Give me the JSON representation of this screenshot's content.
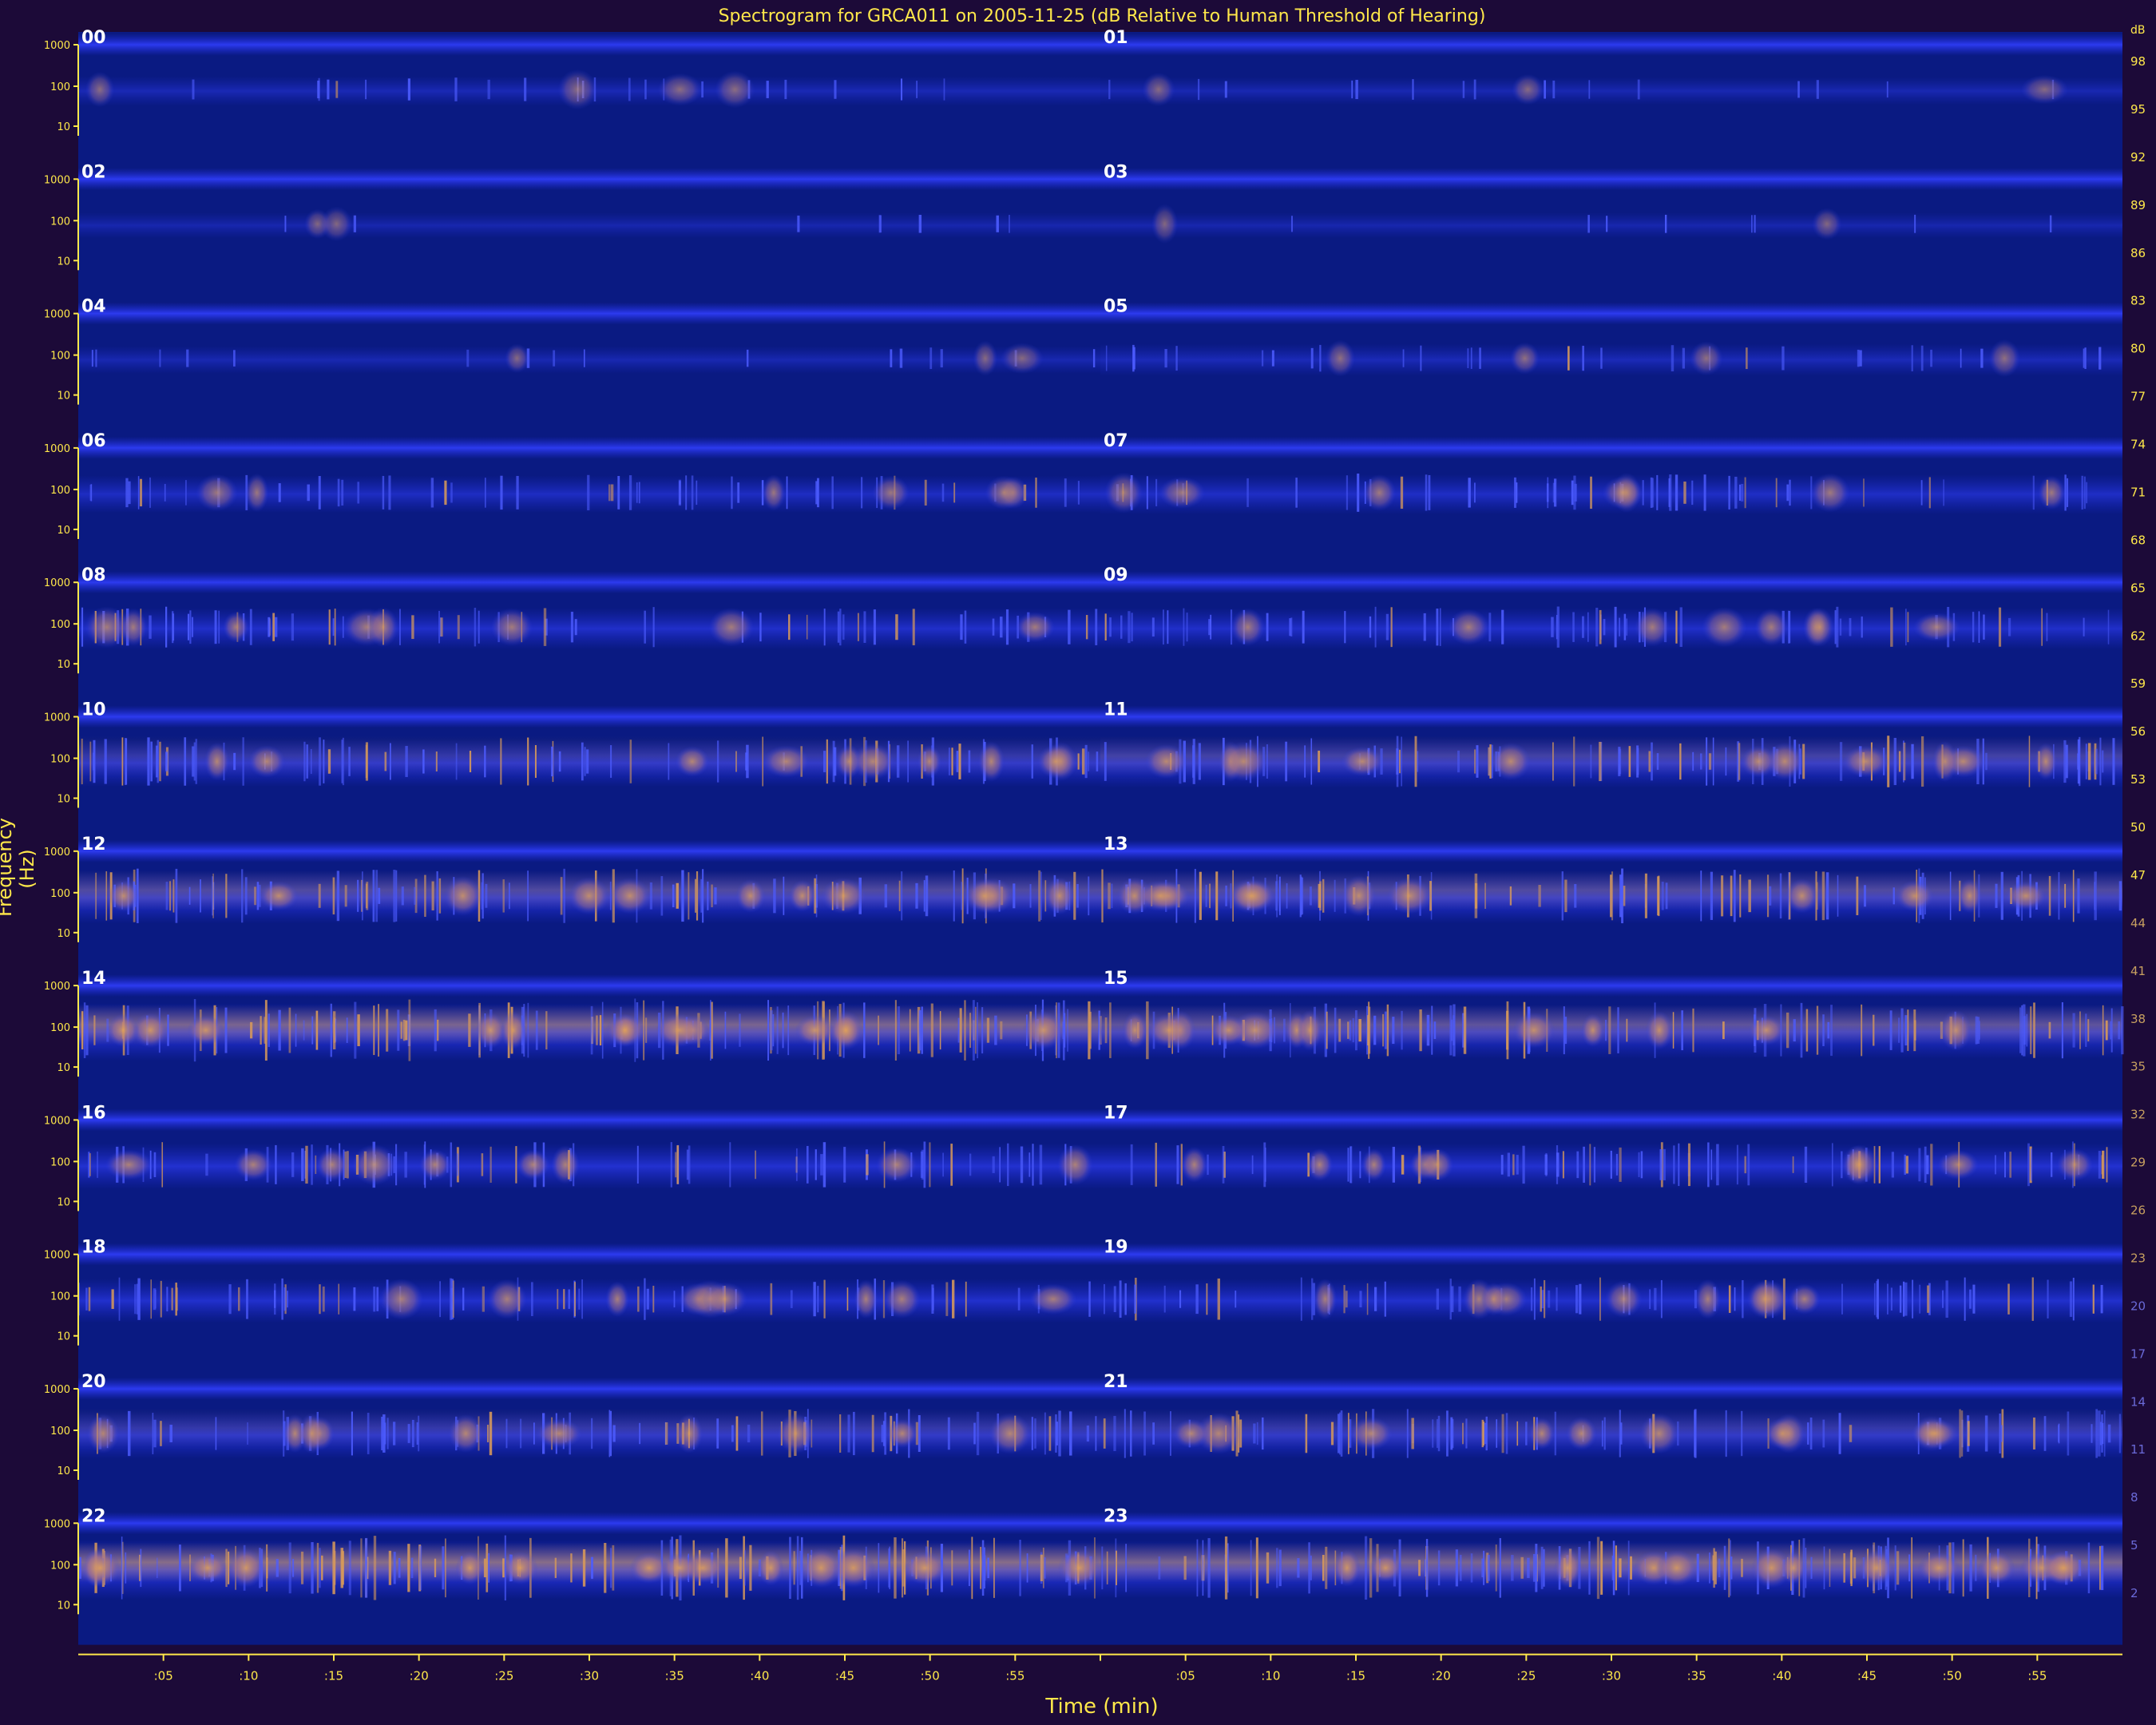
{
  "chart_data": {
    "type": "heatmap",
    "title": "Spectrogram for GRCA011 on 2005-11-25 (dB Relative to Human Threshold of Hearing)",
    "xlabel": "Time (min)",
    "ylabel": "Frequency (Hz)",
    "hour_rows": [
      [
        "00",
        "01"
      ],
      [
        "02",
        "03"
      ],
      [
        "04",
        "05"
      ],
      [
        "06",
        "07"
      ],
      [
        "08",
        "09"
      ],
      [
        "10",
        "11"
      ],
      [
        "12",
        "13"
      ],
      [
        "14",
        "15"
      ],
      [
        "16",
        "17"
      ],
      [
        "18",
        "19"
      ],
      [
        "20",
        "21"
      ],
      [
        "22",
        "23"
      ]
    ],
    "freq_ticks": [
      "1000",
      "100",
      "10"
    ],
    "time_ticks": [
      ":05",
      ":10",
      ":15",
      ":20",
      ":25",
      ":30",
      ":35",
      ":40",
      ":45",
      ":50",
      ":55",
      "",
      ":05",
      ":10",
      ":15",
      ":20",
      ":25",
      ":30",
      ":35",
      ":40",
      ":45",
      ":50",
      ":55"
    ],
    "colorbar_unit": "dB",
    "colorbar_ticks": [
      "98",
      "95",
      "92",
      "89",
      "86",
      "83",
      "80",
      "77",
      "74",
      "71",
      "68",
      "65",
      "62",
      "59",
      "56",
      "53",
      "50",
      "47",
      "44",
      "41",
      "38",
      "35",
      "32",
      "29",
      "26",
      "23",
      "20",
      "17",
      "14",
      "11",
      "8",
      "5",
      "2"
    ],
    "band_activity": [
      {
        "hour": "00",
        "level": 0.15
      },
      {
        "hour": "01",
        "level": 0.1
      },
      {
        "hour": "02",
        "level": 0.05
      },
      {
        "hour": "03",
        "level": 0.05
      },
      {
        "hour": "04",
        "level": 0.1
      },
      {
        "hour": "05",
        "level": 0.2
      },
      {
        "hour": "06",
        "level": 0.35
      },
      {
        "hour": "07",
        "level": 0.4
      },
      {
        "hour": "08",
        "level": 0.45
      },
      {
        "hour": "09",
        "level": 0.45
      },
      {
        "hour": "10",
        "level": 0.6
      },
      {
        "hour": "11",
        "level": 0.65
      },
      {
        "hour": "12",
        "level": 0.7
      },
      {
        "hour": "13",
        "level": 0.7
      },
      {
        "hour": "14",
        "level": 0.85
      },
      {
        "hour": "15",
        "level": 0.75
      },
      {
        "hour": "16",
        "level": 0.55
      },
      {
        "hour": "17",
        "level": 0.55
      },
      {
        "hour": "18",
        "level": 0.5
      },
      {
        "hour": "19",
        "level": 0.5
      },
      {
        "hour": "20",
        "level": 0.6
      },
      {
        "hour": "21",
        "level": 0.6
      },
      {
        "hour": "22",
        "level": 0.9
      },
      {
        "hour": "23",
        "level": 0.85
      }
    ]
  }
}
